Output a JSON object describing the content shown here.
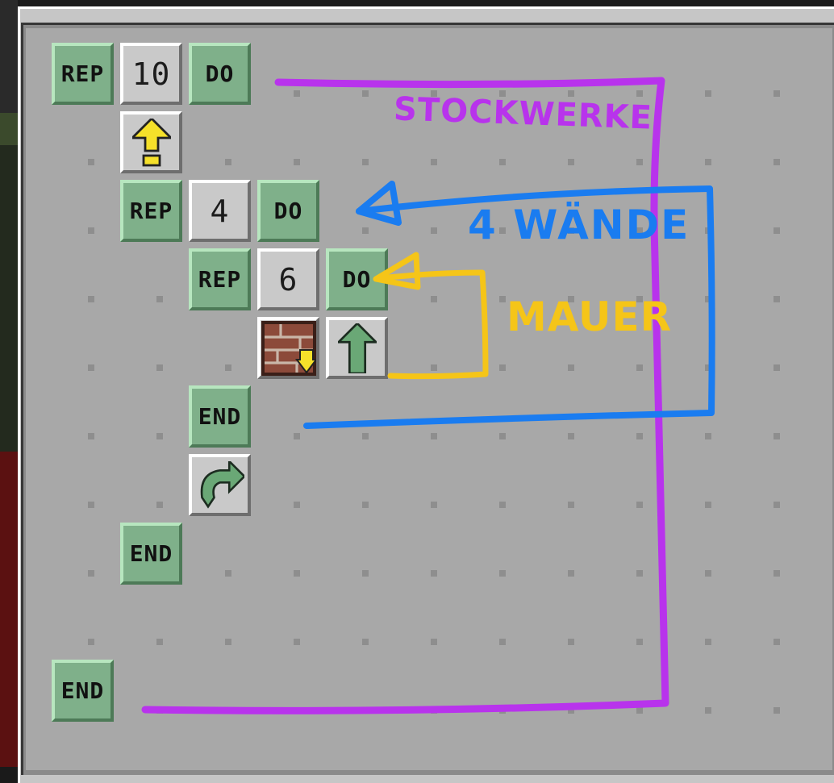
{
  "program": {
    "tiles": [
      {
        "name": "repeat-block",
        "label": "REP",
        "kind": "green",
        "col": 0,
        "row": 0
      },
      {
        "name": "count-value",
        "label": "10",
        "kind": "gray",
        "col": 1,
        "row": 0
      },
      {
        "name": "do-block",
        "label": "DO",
        "kind": "green",
        "col": 2,
        "row": 0
      },
      {
        "name": "move-up-icon",
        "label": "",
        "kind": "gray",
        "col": 1,
        "row": 1
      },
      {
        "name": "repeat-block",
        "label": "REP",
        "kind": "green",
        "col": 1,
        "row": 2
      },
      {
        "name": "count-value",
        "label": "4",
        "kind": "gray",
        "col": 2,
        "row": 2
      },
      {
        "name": "do-block",
        "label": "DO",
        "kind": "green",
        "col": 3,
        "row": 2
      },
      {
        "name": "repeat-block",
        "label": "REP",
        "kind": "green",
        "col": 2,
        "row": 3
      },
      {
        "name": "count-value",
        "label": "6",
        "kind": "gray",
        "col": 3,
        "row": 3
      },
      {
        "name": "do-block",
        "label": "DO",
        "kind": "green",
        "col": 4,
        "row": 3
      },
      {
        "name": "place-brick-icon",
        "label": "",
        "kind": "gray",
        "col": 3,
        "row": 4
      },
      {
        "name": "move-forward-icon",
        "label": "",
        "kind": "gray",
        "col": 4,
        "row": 4
      },
      {
        "name": "end-block",
        "label": "END",
        "kind": "green",
        "col": 2,
        "row": 5
      },
      {
        "name": "turn-right-icon",
        "label": "",
        "kind": "gray",
        "col": 2,
        "row": 6
      },
      {
        "name": "end-block",
        "label": "END",
        "kind": "green",
        "col": 1,
        "row": 7
      },
      {
        "name": "end-block",
        "label": "END",
        "kind": "green",
        "col": 0,
        "row": 9
      }
    ]
  },
  "annotations": {
    "floors_label": "STOCKWERKE",
    "walls_label": "4 WÄNDE",
    "wall_label": "MAUER"
  },
  "colors": {
    "floors": "#b833ec",
    "walls": "#1a7cf0",
    "wall": "#f5c518"
  }
}
